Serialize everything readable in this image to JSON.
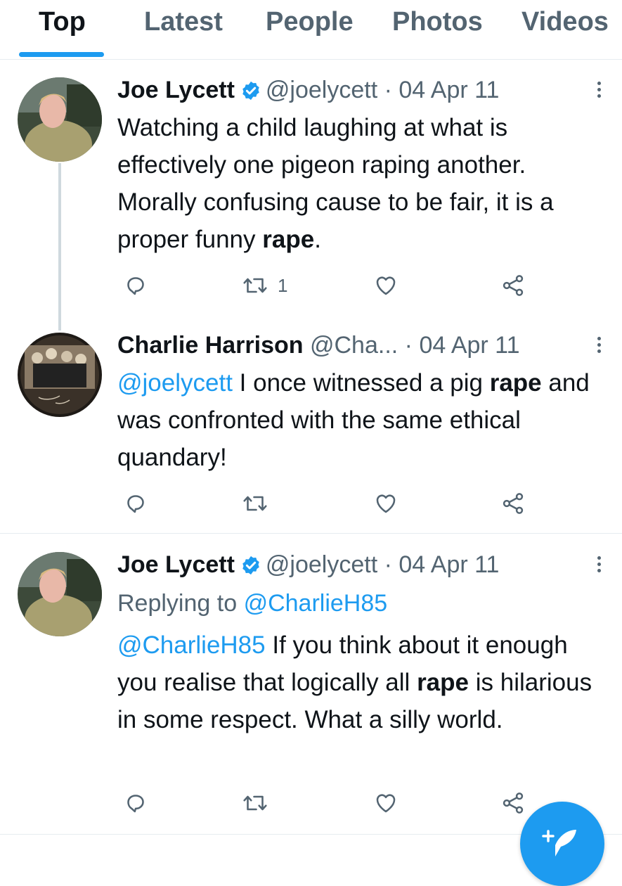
{
  "tabs": [
    {
      "label": "Top",
      "active": true
    },
    {
      "label": "Latest"
    },
    {
      "label": "People"
    },
    {
      "label": "Photos"
    },
    {
      "label": "Videos"
    }
  ],
  "tweets": [
    {
      "name": "Joe Lycett",
      "verified": true,
      "handle": "@joelycett",
      "date": "04 Apr 11",
      "text_parts": [
        "Watching a child laughing at what is effectively one pigeon raping another. Morally confusing cause to be fair, it is a proper funny ",
        "rape",
        "."
      ],
      "retweets": "1"
    },
    {
      "name": "Charlie Harrison",
      "verified": false,
      "handle": "@Cha...",
      "date": "04 Apr 11",
      "mention": "@joelycett",
      "text_parts": [
        " I once witnessed a pig ",
        "rape",
        " and was confronted with the same ethical quandary!"
      ]
    },
    {
      "name": "Joe Lycett",
      "verified": true,
      "handle": "@joelycett",
      "date": "04 Apr 11",
      "replying_to_label": "Replying to",
      "replying_to_handle": "@CharlieH85",
      "mention": "@CharlieH85",
      "text_parts": [
        " If you think about it enough you realise that logically all ",
        "rape",
        " is hilarious in some respect. What a silly world."
      ]
    }
  ],
  "icons": {
    "reply": "reply-icon",
    "retweet": "retweet-icon",
    "like": "heart-icon",
    "share": "share-icon",
    "compose": "compose-tweet-icon"
  },
  "colors": {
    "accent": "#1d9bf0",
    "secondary_text": "#536471",
    "primary_text": "#0f1419"
  }
}
